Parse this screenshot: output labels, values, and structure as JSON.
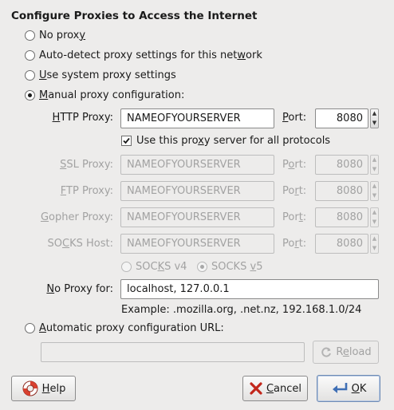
{
  "title": "Configure Proxies to Access the Internet",
  "options": {
    "no_proxy": {
      "pre": "No prox",
      "mn": "y",
      "post": ""
    },
    "auto_detect": {
      "pre": "Auto-detect proxy settings for this net",
      "mn": "w",
      "post": "ork"
    },
    "system": {
      "pre": "",
      "mn": "U",
      "post": "se system proxy settings"
    },
    "manual": {
      "pre": "",
      "mn": "M",
      "post": "anual proxy configuration:"
    },
    "auto_url": {
      "pre": "",
      "mn": "A",
      "post": "utomatic proxy configuration URL:"
    }
  },
  "http": {
    "label_mn": "H",
    "label_rest": "TTP Proxy:",
    "value": "NAMEOFYOURSERVER",
    "port_mn": "P",
    "port_rest": "ort:",
    "port": "8080"
  },
  "use_for_all": {
    "pre": "Use this pro",
    "mn": "x",
    "post": "y server for all protocols"
  },
  "ssl": {
    "label_pre": "",
    "label_mn": "S",
    "label_rest": "SL Proxy:",
    "value": "NAMEOFYOURSERVER",
    "port_pre": "P",
    "port_mn": "o",
    "port_rest": "rt:",
    "port": "8080"
  },
  "ftp": {
    "label_mn": "F",
    "label_rest": "TP Proxy:",
    "value": "NAMEOFYOURSERVER",
    "port_pre": "Po",
    "port_mn": "r",
    "port_rest": "t:",
    "port": "8080"
  },
  "gopher": {
    "label_mn": "G",
    "label_rest": "opher Proxy:",
    "value": "NAMEOFYOURSERVER",
    "port_pre": "Por",
    "port_mn": "t",
    "port_rest": ":",
    "port": "8080"
  },
  "socks": {
    "label_pre": "SO",
    "label_mn": "C",
    "label_rest": "KS Host:",
    "value": "NAMEOFYOURSERVER",
    "port_pre": "Po",
    "port_mn": "r",
    "port_rest": "t:",
    "port": "8080"
  },
  "socks_v4": {
    "pre": "SOC",
    "mn": "K",
    "post": "S v4"
  },
  "socks_v5": {
    "pre": "SOCKS ",
    "mn": "v",
    "post": "5"
  },
  "no_proxy_for": {
    "label_mn": "N",
    "label_rest": "o Proxy for:",
    "value": "localhost, 127.0.0.1"
  },
  "example": "Example: .mozilla.org, .net.nz, 192.168.1.0/24",
  "auto_url_value": "",
  "reload": {
    "pre": "R",
    "mn": "e",
    "post": "load"
  },
  "buttons": {
    "help": {
      "mn": "H",
      "rest": "elp"
    },
    "cancel": {
      "pre": "",
      "mn": "C",
      "post": "ancel"
    },
    "ok": {
      "mn": "O",
      "rest": "K"
    }
  }
}
